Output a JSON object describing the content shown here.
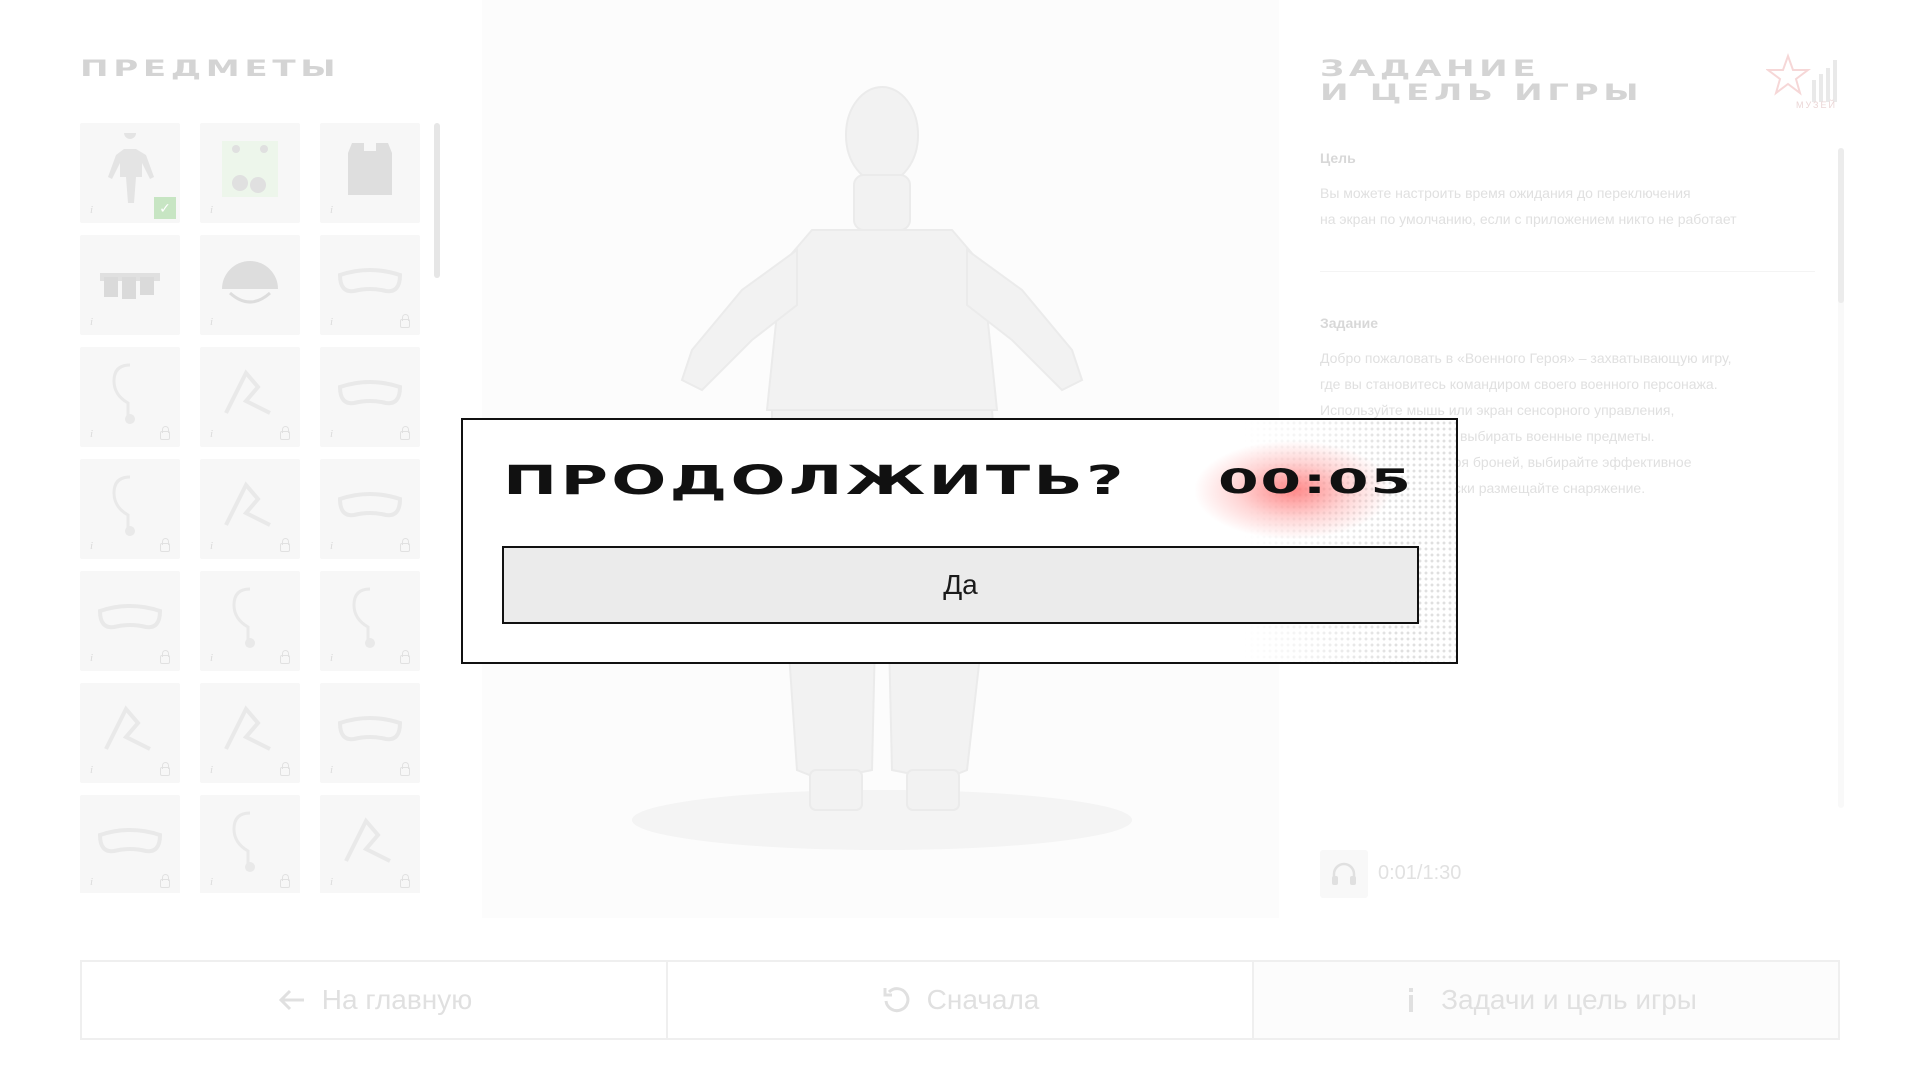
{
  "items_panel": {
    "title": "Предметы",
    "info_glyph": "i",
    "cells": [
      {
        "icon": "uniform-icon",
        "selected": true
      },
      {
        "icon": "gloves-icon",
        "selected": false
      },
      {
        "icon": "vest-icon",
        "selected": false
      },
      {
        "icon": "belt-pouches-icon",
        "selected": false
      },
      {
        "icon": "helmet-icon",
        "selected": false
      },
      {
        "icon": "goggles-icon",
        "selected": false
      },
      {
        "icon": "earpiece-icon",
        "selected": false
      },
      {
        "icon": "sling-icon",
        "selected": false
      },
      {
        "icon": "goggles-icon",
        "selected": false
      },
      {
        "icon": "earpiece-icon",
        "selected": false
      },
      {
        "icon": "sling-icon",
        "selected": false
      },
      {
        "icon": "goggles-icon",
        "selected": false
      },
      {
        "icon": "goggles-icon",
        "selected": false
      },
      {
        "icon": "earpiece-icon",
        "selected": false
      },
      {
        "icon": "earpiece-icon",
        "selected": false
      },
      {
        "icon": "sling-icon",
        "selected": false
      },
      {
        "icon": "sling-icon",
        "selected": false
      },
      {
        "icon": "goggles-icon",
        "selected": false
      },
      {
        "icon": "goggles-icon",
        "selected": false
      },
      {
        "icon": "earpiece-icon",
        "selected": false
      },
      {
        "icon": "sling-icon",
        "selected": false
      }
    ]
  },
  "task_panel": {
    "title_line1": "Задание",
    "title_line2": "и цель игры",
    "goal_label": "Цель",
    "goal_text_line1": "Вы можете настроить время ожидания до переключения",
    "goal_text_line2": "на экран по умолчанию, если с приложением никто не работает",
    "task_label": "Задание",
    "task_text_line1": "Добро пожаловать в «Военного Героя» – захватывающую игру,",
    "task_text_line2": "где вы становитесь командиром своего военного персонажа.",
    "task_text_line3": "Используйте мышь или экран сенсорного управления,",
    "task_text_line4": "чтобы перемещать и выбирать военные предметы.",
    "task_text_line5": "Снабдите своего героя броней, выбирайте эффективное",
    "task_text_line6": "оружие и стратегически размещайте снаряжение.",
    "audio_time": "0:01/1:30",
    "logo_text": "МУЗЕЙ"
  },
  "bottom_nav": {
    "home_label": "На главную",
    "restart_label": "Сначала",
    "tasks_label": "Задачи и цель игры",
    "home_icon": "arrow-left-icon",
    "restart_icon": "restart-icon",
    "tasks_icon": "info-icon"
  },
  "modal": {
    "title": "Продолжить?",
    "timer": "00:05",
    "confirm_label": "Да",
    "glow_color": "#ff2a2a"
  }
}
